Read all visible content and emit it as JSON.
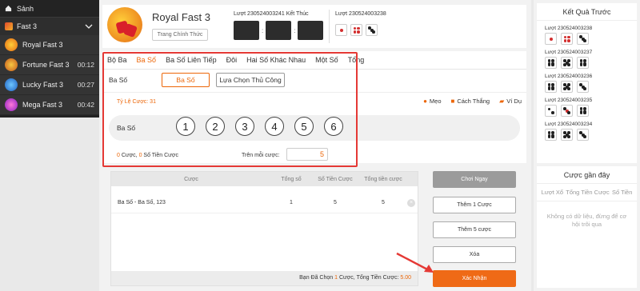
{
  "sidebar": {
    "home_label": "Sảnh",
    "category_label": "Fast 3",
    "games": [
      {
        "label": "Royal Fast 3",
        "timer": ""
      },
      {
        "label": "Fortune Fast 3",
        "timer": "00:12"
      },
      {
        "label": "Lucky Fast 3",
        "timer": "00:27"
      },
      {
        "label": "Mega Fast 3",
        "timer": "00:42"
      }
    ]
  },
  "header": {
    "title": "Royal Fast 3",
    "home_button": "Trang Chính Thức",
    "prev_round_text": "Lượt 230524003241 Kết Thúc",
    "slot_separator": ":",
    "current_round_text": "Lượt 230524003238"
  },
  "bet": {
    "tabs": [
      "Bộ Ba",
      "Ba Số",
      "Ba Số Liên Tiếp",
      "Đôi",
      "Hai Số Khác Nhau",
      "Một Số",
      "Tổng"
    ],
    "mode_label": "Ba Số",
    "mode_button": "Ba Số",
    "manual_button": "Lựa Chọn Thủ Công",
    "ratio_text": "Tỷ Lệ Cược: 31",
    "help_tip": "Mẹo",
    "help_howto": "Cách Thắng",
    "help_example": "Ví Dụ",
    "numbers_label": "Ba Số",
    "numbers": [
      "1",
      "2",
      "3",
      "4",
      "5",
      "6"
    ],
    "summary_count": "0",
    "summary_mid": " Cược, ",
    "summary_amount": "0",
    "summary_end": " Số Tiền Cược",
    "per_bet_label": "Trên mỗi cược:",
    "per_bet_value": "5"
  },
  "table": {
    "headers": [
      "Cược",
      "Tổng số",
      "Số Tiền Cược",
      "Tổng tiền cược"
    ],
    "rows": [
      {
        "name": "Ba Số - Ba Số, 123",
        "count": "1",
        "amount": "5",
        "total": "5"
      }
    ],
    "footer_prefix": "Bạn Đã Chọn ",
    "footer_count": "1",
    "footer_mid": " Cược, Tổng Tiền Cược: ",
    "footer_total": "5.00"
  },
  "actions": {
    "play_now": "Chơi Ngay",
    "add1": "Thêm 1 Cược",
    "add5": "Thêm 5 cược",
    "delete": "Xóa",
    "confirm": "Xác Nhận"
  },
  "results": {
    "title": "Kết Quả Trước",
    "rounds": [
      "230524003238",
      "230524003237",
      "230524003236",
      "230524003235",
      "230524003234"
    ],
    "round_prefix": "Lượt "
  },
  "recent": {
    "title": "Cược gần đây",
    "col_round": "Lượt Xổ",
    "col_total": "Tổng Tiền Cược",
    "col_win": "Số Tiền",
    "empty": "Không có dữ liệu, đừng để cơ hội trôi qua"
  },
  "colors": {
    "accent": "#ec6608",
    "highlight": "#e53935",
    "sidebar": "#232323"
  }
}
